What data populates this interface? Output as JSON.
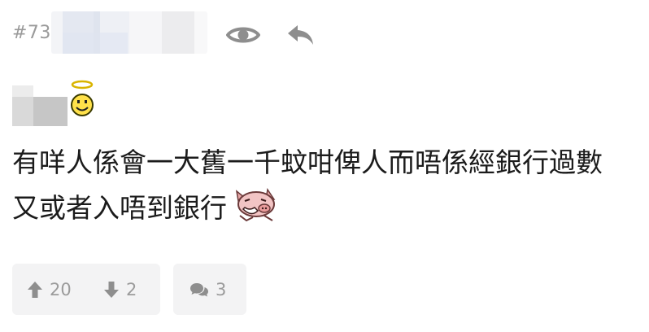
{
  "post": {
    "number": "#73",
    "icons": {
      "view": "eye-icon",
      "reply": "reply-icon",
      "badge": "angel-smiley-icon",
      "emoji": "pig-laugh-icon"
    },
    "content_lines": [
      "有咩人係會一大舊一千蚊咁俾人而唔係經銀行過數",
      "又或者入唔到銀行"
    ]
  },
  "actions": {
    "upvotes": "20",
    "downvotes": "2",
    "comments": "3"
  },
  "colors": {
    "meta_text": "#9a9a9a",
    "icon_gray": "#8e8e8e",
    "action_bg": "#f3f3f4"
  }
}
